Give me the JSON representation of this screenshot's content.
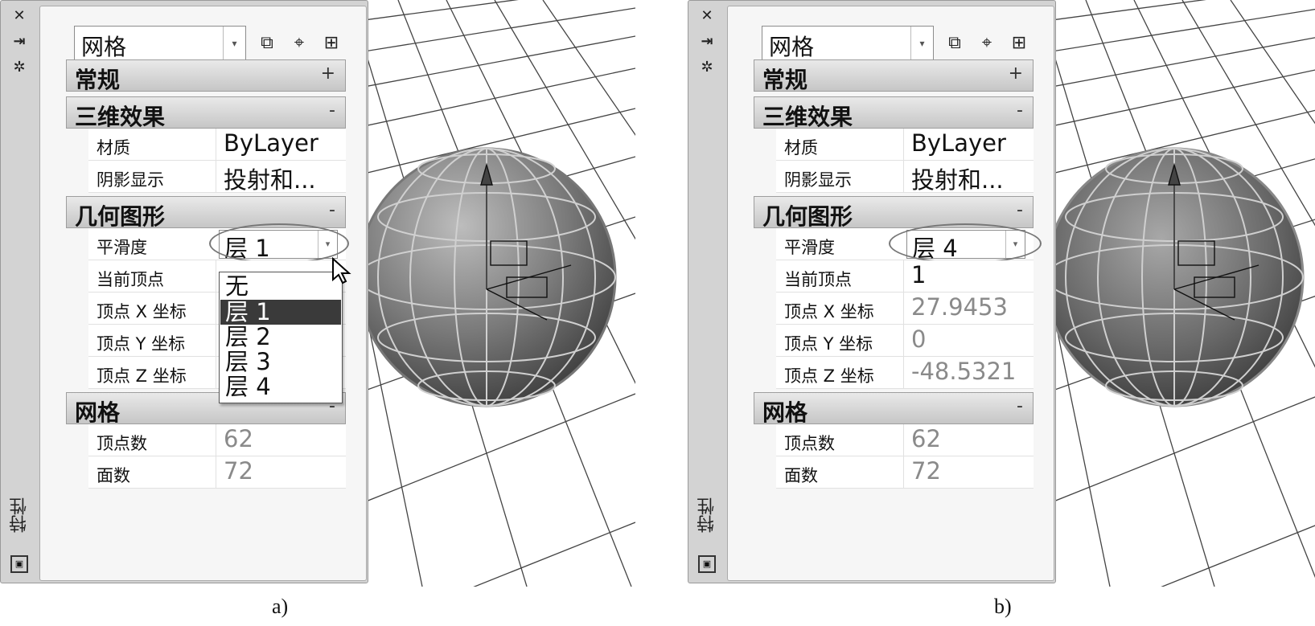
{
  "panels": [
    {
      "id": "a",
      "caption": "a)",
      "side_title": "特性",
      "object_type": "网格",
      "sections": {
        "general": {
          "title": "常规",
          "toggle": "+"
        },
        "effects": {
          "title": "三维效果",
          "toggle": "-"
        },
        "geometry": {
          "title": "几何图形",
          "toggle": "-"
        },
        "mesh": {
          "title": "网格",
          "toggle": "-"
        }
      },
      "rows": {
        "material": {
          "label": "材质",
          "value": "ByLayer"
        },
        "shadow": {
          "label": "阴影显示",
          "value": "投射和..."
        },
        "smoothness": {
          "label": "平滑度",
          "value": "层 1"
        },
        "vertex": {
          "label": "当前顶点",
          "value": ""
        },
        "vx": {
          "label": "顶点 X 坐标",
          "value": ""
        },
        "vy": {
          "label": "顶点 Y 坐标",
          "value": ""
        },
        "vz": {
          "label": "顶点 Z 坐标",
          "value": ""
        },
        "vertex_count": {
          "label": "顶点数",
          "value": "62"
        },
        "face_count": {
          "label": "面数",
          "value": "72"
        }
      },
      "dropdown": {
        "open": true,
        "options": [
          "无",
          "层 1",
          "层 2",
          "层 3",
          "层 4"
        ],
        "selected": "层 1"
      }
    },
    {
      "id": "b",
      "caption": "b)",
      "side_title": "特性",
      "object_type": "网格",
      "sections": {
        "general": {
          "title": "常规",
          "toggle": "+"
        },
        "effects": {
          "title": "三维效果",
          "toggle": "-"
        },
        "geometry": {
          "title": "几何图形",
          "toggle": "-"
        },
        "mesh": {
          "title": "网格",
          "toggle": "-"
        }
      },
      "rows": {
        "material": {
          "label": "材质",
          "value": "ByLayer"
        },
        "shadow": {
          "label": "阴影显示",
          "value": "投射和..."
        },
        "smoothness": {
          "label": "平滑度",
          "value": "层 4"
        },
        "vertex": {
          "label": "当前顶点",
          "value": "1"
        },
        "vx": {
          "label": "顶点 X 坐标",
          "value": "27.9453"
        },
        "vy": {
          "label": "顶点 Y 坐标",
          "value": "0"
        },
        "vz": {
          "label": "顶点 Z 坐标",
          "value": "-48.5321"
        },
        "vertex_count": {
          "label": "顶点数",
          "value": "62"
        },
        "face_count": {
          "label": "面数",
          "value": "72"
        }
      },
      "dropdown": {
        "open": false
      }
    }
  ],
  "icons": {
    "close": "close-icon",
    "autohide": "autohide-icon",
    "settings": "settings-icon",
    "quick_select": "quick-select-icon",
    "select_objects": "select-objects-icon",
    "toggle_pickadd": "toggle-pickadd-icon"
  },
  "colors": {
    "sphere_light": "#b5b5b5",
    "sphere_dark": "#4a4a4a",
    "grid": "#444444"
  }
}
